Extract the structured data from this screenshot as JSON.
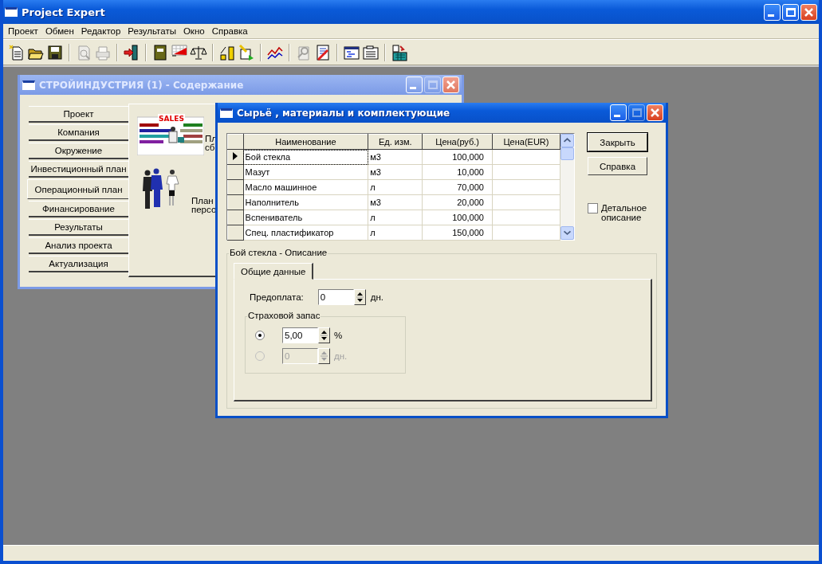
{
  "window": {
    "title": "Project Expert",
    "controls": [
      {
        "kind": "minimize",
        "disabled": false
      },
      {
        "kind": "maximize",
        "disabled": false
      },
      {
        "kind": "close",
        "disabled": false
      }
    ]
  },
  "menu": [
    {
      "label": "Проект"
    },
    {
      "label": "Обмен"
    },
    {
      "label": "Редактор"
    },
    {
      "label": "Результаты"
    },
    {
      "label": "Окно"
    },
    {
      "label": "Справка"
    }
  ],
  "toolbar": [
    {
      "kind": "new-document",
      "disabled": false
    },
    {
      "kind": "open-folder",
      "disabled": false
    },
    {
      "kind": "save",
      "disabled": false
    },
    {
      "kind": "separator"
    },
    {
      "kind": "preview",
      "disabled": true
    },
    {
      "kind": "print",
      "disabled": true
    },
    {
      "kind": "separator"
    },
    {
      "kind": "exit",
      "disabled": false
    },
    {
      "kind": "separator"
    },
    {
      "kind": "notebook",
      "disabled": false
    },
    {
      "kind": "cashflow",
      "disabled": false
    },
    {
      "kind": "scales",
      "disabled": false
    },
    {
      "kind": "separator"
    },
    {
      "kind": "ruler",
      "disabled": false
    },
    {
      "kind": "export",
      "disabled": false
    },
    {
      "kind": "separator"
    },
    {
      "kind": "line-chart",
      "disabled": false
    },
    {
      "kind": "separator"
    },
    {
      "kind": "magnifier",
      "disabled": true
    },
    {
      "kind": "edit",
      "disabled": false
    },
    {
      "kind": "separator"
    },
    {
      "kind": "window-list",
      "disabled": false
    },
    {
      "kind": "clipboard",
      "disabled": false
    },
    {
      "kind": "separator"
    },
    {
      "kind": "calculator",
      "disabled": false
    }
  ],
  "content_window": {
    "title": "СТРОЙИНДУСТРИЯ (1) - Содержание",
    "active": false,
    "controls": [
      {
        "kind": "minimize",
        "disabled": false
      },
      {
        "kind": "maximize",
        "disabled": true
      },
      {
        "kind": "close",
        "disabled": false
      }
    ],
    "sections": [
      {
        "label": "Проект",
        "selected": false
      },
      {
        "label": "Компания",
        "selected": false
      },
      {
        "label": "Окружение",
        "selected": false
      },
      {
        "label": "Инвестиционный план",
        "selected": false
      },
      {
        "label": "Операционный план",
        "selected": true
      },
      {
        "label": "Финансирование",
        "selected": false
      },
      {
        "label": "Результаты",
        "selected": false
      },
      {
        "label": "Анализ проекта",
        "selected": false
      },
      {
        "label": "Актуализация",
        "selected": false
      }
    ],
    "panel_items": [
      {
        "kind": "sales",
        "sign": "SALES",
        "lines": [
          "Пл",
          "сб"
        ]
      },
      {
        "kind": "staff",
        "lines": [
          "План",
          "персо"
        ]
      }
    ]
  },
  "dialog": {
    "title": "Сырьё , материалы и комплектующие",
    "active": true,
    "controls": [
      {
        "kind": "minimize",
        "disabled": false
      },
      {
        "kind": "maximize",
        "disabled": true
      },
      {
        "kind": "close",
        "disabled": false
      }
    ],
    "table": {
      "columns": [
        "Наименование",
        "Ед. изм.",
        "Цена(руб.)",
        "Цена(EUR)"
      ],
      "rows": [
        {
          "name": "Бой стекла",
          "unit": "м3",
          "price_rub": "100,000",
          "selected": true
        },
        {
          "name": "Мазут",
          "unit": "м3",
          "price_rub": "10,000",
          "selected": false
        },
        {
          "name": "Масло машинное",
          "unit": "л",
          "price_rub": "70,000",
          "selected": false
        },
        {
          "name": "Наполнитель",
          "unit": "м3",
          "price_rub": "20,000",
          "selected": false
        },
        {
          "name": "Вспениватель",
          "unit": "л",
          "price_rub": "100,000",
          "selected": false
        },
        {
          "name": "Спец. пластификатор",
          "unit": "л",
          "price_rub": "150,000",
          "selected": false
        }
      ]
    },
    "buttons": [
      {
        "label": "Закрыть",
        "default": true
      },
      {
        "label": "Справка",
        "default": false
      }
    ],
    "detail_checkbox": {
      "label": "Детальное описание",
      "checked": false
    },
    "description": {
      "title": "Бой стекла - Описание",
      "tabs": [
        {
          "label": "Общие данные",
          "selected": true
        }
      ],
      "prepayment": {
        "label": "Предоплата:",
        "value": "0",
        "unit": "дн."
      },
      "safety_stock": {
        "title": "Страховой запас",
        "options": [
          {
            "value": "5,00",
            "unit": "%",
            "selected": true,
            "disabled": false
          },
          {
            "value": "0",
            "unit": "дн.",
            "selected": false,
            "disabled": true
          }
        ]
      }
    }
  }
}
